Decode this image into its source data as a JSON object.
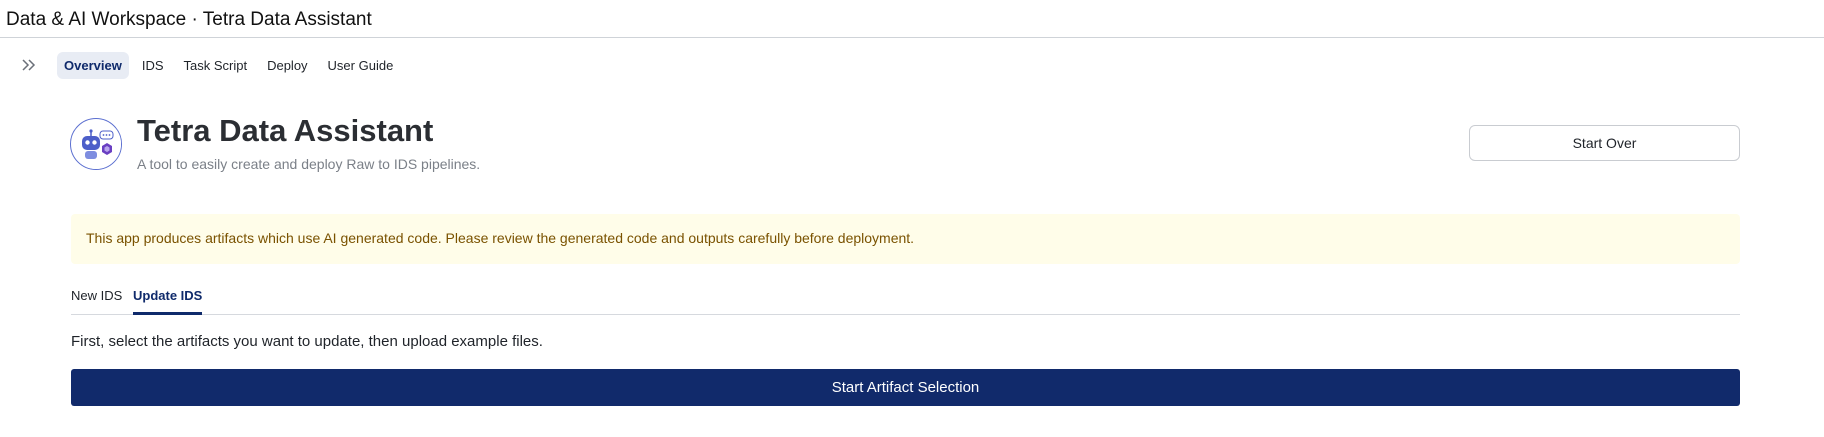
{
  "window": {
    "title": "Data & AI Workspace · Tetra Data Assistant"
  },
  "nav": {
    "expand_icon": "double-chevron-right-icon",
    "tabs": [
      {
        "label": "Overview",
        "active": true
      },
      {
        "label": "IDS",
        "active": false
      },
      {
        "label": "Task Script",
        "active": false
      },
      {
        "label": "Deploy",
        "active": false
      },
      {
        "label": "User Guide",
        "active": false
      }
    ]
  },
  "header": {
    "logo_icon": "robot-assistant-icon",
    "title": "Tetra Data Assistant",
    "subtitle": "A tool to easily create and deploy Raw to IDS pipelines.",
    "start_over_label": "Start Over"
  },
  "warning": {
    "text": "This app produces artifacts which use AI generated code. Please review the generated code and outputs carefully before deployment."
  },
  "sub_tabs": [
    {
      "label": "New IDS",
      "active": false
    },
    {
      "label": "Update IDS",
      "active": true
    }
  ],
  "content": {
    "instruction": "First, select the artifacts you want to update, then upload example files.",
    "primary_button_label": "Start Artifact Selection"
  },
  "colors": {
    "primary": "#112a6b",
    "warning_bg": "#fffde9",
    "warning_text": "#7a5200",
    "active_tab_bg": "#e8ecf4"
  }
}
